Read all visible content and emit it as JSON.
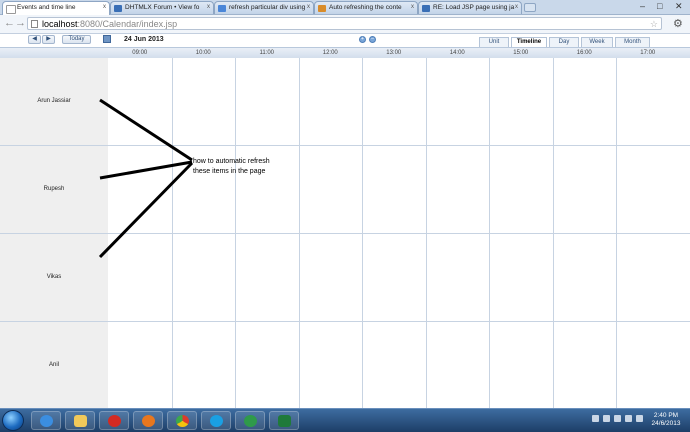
{
  "browser": {
    "tabs": [
      {
        "label": "Events and time line",
        "active": true,
        "icon_color": "#ffffff"
      },
      {
        "label": "DHTMLX Forum • View fo",
        "active": false,
        "icon_color": "#3a6fb6"
      },
      {
        "label": "refresh particular div using",
        "active": false,
        "icon_color": "#4a86d8"
      },
      {
        "label": "Auto refreshing the conte",
        "active": false,
        "icon_color": "#d98c2a"
      },
      {
        "label": "RE: Load JSP page using ja",
        "active": false,
        "icon_color": "#3a6fb6"
      }
    ],
    "window_controls": {
      "minimize": "–",
      "maximize": "□",
      "close": "✕"
    },
    "tab_close": "x",
    "address": {
      "host": "localhost",
      "path": ":8080/Calendar/index.jsp"
    },
    "back": "←",
    "forward": "→",
    "star": "☆",
    "wrench": "⚙"
  },
  "scheduler": {
    "prev": "◀",
    "next": "▶",
    "today_label": "Today",
    "date_label": "24 Jun 2013",
    "zoom_in": "+",
    "zoom_out": "–",
    "views": [
      {
        "label": "Unit",
        "active": false
      },
      {
        "label": "Timeline",
        "active": true
      },
      {
        "label": "Day",
        "active": false
      },
      {
        "label": "Week",
        "active": false
      },
      {
        "label": "Month",
        "active": false
      }
    ],
    "hours": [
      "09:00",
      "10:00",
      "11:00",
      "12:00",
      "13:00",
      "14:00",
      "15:00",
      "16:00",
      "17:00"
    ],
    "sections": [
      "Arun Jassiar",
      "Rupesh",
      "Vikas",
      "Anil"
    ],
    "annotation_line1": "how to automatic refresh",
    "annotation_line2": "these items in the page"
  },
  "taskbar": {
    "apps": [
      {
        "name": "ie",
        "color": "#3b8ee0"
      },
      {
        "name": "folder",
        "color": "#f1c95a"
      },
      {
        "name": "opera",
        "color": "#d32a22"
      },
      {
        "name": "firefox",
        "color": "#e8771e"
      },
      {
        "name": "chrome",
        "color": "#3ba84d"
      },
      {
        "name": "skype",
        "color": "#1aa0e3"
      },
      {
        "name": "app-green",
        "color": "#2f9a4a"
      },
      {
        "name": "excel",
        "color": "#1f7a3a"
      }
    ],
    "clock_time": "2:40 PM",
    "clock_date": "24/6/2013"
  }
}
